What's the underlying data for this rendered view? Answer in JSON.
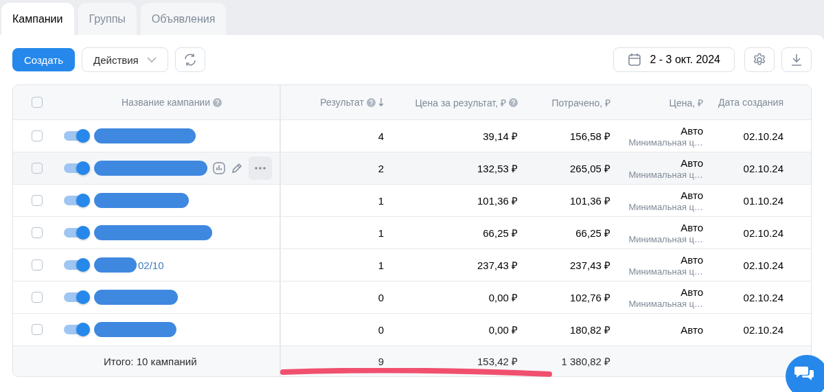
{
  "tabs": [
    {
      "label": "Кампании",
      "selected": true
    },
    {
      "label": "Группы",
      "selected": false
    },
    {
      "label": "Объявления",
      "selected": false
    }
  ],
  "toolbar": {
    "create": "Создать",
    "actions": "Действия",
    "date_range": "2 - 3 окт. 2024"
  },
  "table": {
    "select_all_checked": false,
    "columns": [
      {
        "label": "Название кампании",
        "help": true,
        "sort": false
      },
      {
        "label": "Результат",
        "help": true,
        "sort": true
      },
      {
        "label": "Цена за результат, ₽",
        "help": true,
        "sort": false
      },
      {
        "label": "Потрачено, ₽",
        "help": false,
        "sort": false
      },
      {
        "label": "Цена, ₽",
        "help": false,
        "sort": false
      },
      {
        "label": "Дата создания",
        "help": false,
        "sort": false
      }
    ],
    "rows": [
      {
        "checked": false,
        "on": true,
        "hovered": false,
        "name_suffix": "",
        "result": "4",
        "cost_per_result": "39,14 ₽",
        "spent": "156,58 ₽",
        "price": "Авто",
        "price_note": "Минимальная ц…",
        "created": "02.10.24"
      },
      {
        "checked": false,
        "on": true,
        "hovered": true,
        "name_suffix": "",
        "result": "2",
        "cost_per_result": "132,53 ₽",
        "spent": "265,05 ₽",
        "price": "Авто",
        "price_note": "Минимальная ц…",
        "created": "02.10.24"
      },
      {
        "checked": false,
        "on": true,
        "hovered": false,
        "name_suffix": "",
        "result": "1",
        "cost_per_result": "101,36 ₽",
        "spent": "101,36 ₽",
        "price": "Авто",
        "price_note": "Минимальная ц…",
        "created": "01.10.24"
      },
      {
        "checked": false,
        "on": true,
        "hovered": false,
        "name_suffix": "",
        "result": "1",
        "cost_per_result": "66,25 ₽",
        "spent": "66,25 ₽",
        "price": "Авто",
        "price_note": "Минимальная ц…",
        "created": "02.10.24"
      },
      {
        "checked": false,
        "on": true,
        "hovered": false,
        "name_suffix": "02/10",
        "result": "1",
        "cost_per_result": "237,43 ₽",
        "spent": "237,43 ₽",
        "price": "Авто",
        "price_note": "Минимальная ц…",
        "created": "02.10.24"
      },
      {
        "checked": false,
        "on": true,
        "hovered": false,
        "name_suffix": "",
        "result": "0",
        "cost_per_result": "0,00 ₽",
        "spent": "102,76 ₽",
        "price": "Авто",
        "price_note": "Минимальная ц…",
        "created": "02.10.24"
      },
      {
        "checked": false,
        "on": true,
        "hovered": false,
        "name_suffix": "",
        "result": "0",
        "cost_per_result": "0,00 ₽",
        "spent": "180,82 ₽",
        "price": "Авто",
        "price_note": "",
        "created": "02.10.24"
      }
    ],
    "totals": {
      "label": "Итого: 10 кампаний",
      "result": "9",
      "cost_per_result": "153,42 ₽",
      "spent": "1 380,82 ₽"
    }
  }
}
